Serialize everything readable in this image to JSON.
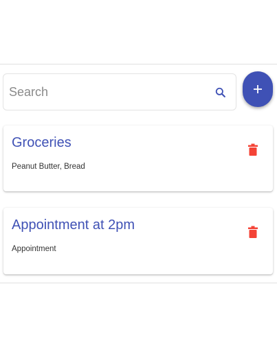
{
  "search": {
    "placeholder": "Search",
    "value": "",
    "icon": "search-icon"
  },
  "add_button": {
    "label": "+",
    "icon": "plus-icon",
    "color": "#3f51b5"
  },
  "notes": [
    {
      "title": "Groceries",
      "body": "Peanut Butter, Bread",
      "delete_icon": "trash-icon"
    },
    {
      "title": "Appointment at 2pm",
      "body": "Appointment",
      "delete_icon": "trash-icon"
    }
  ],
  "colors": {
    "accent": "#3f51b5",
    "delete": "#f44336",
    "title_text": "#3f51b5"
  }
}
